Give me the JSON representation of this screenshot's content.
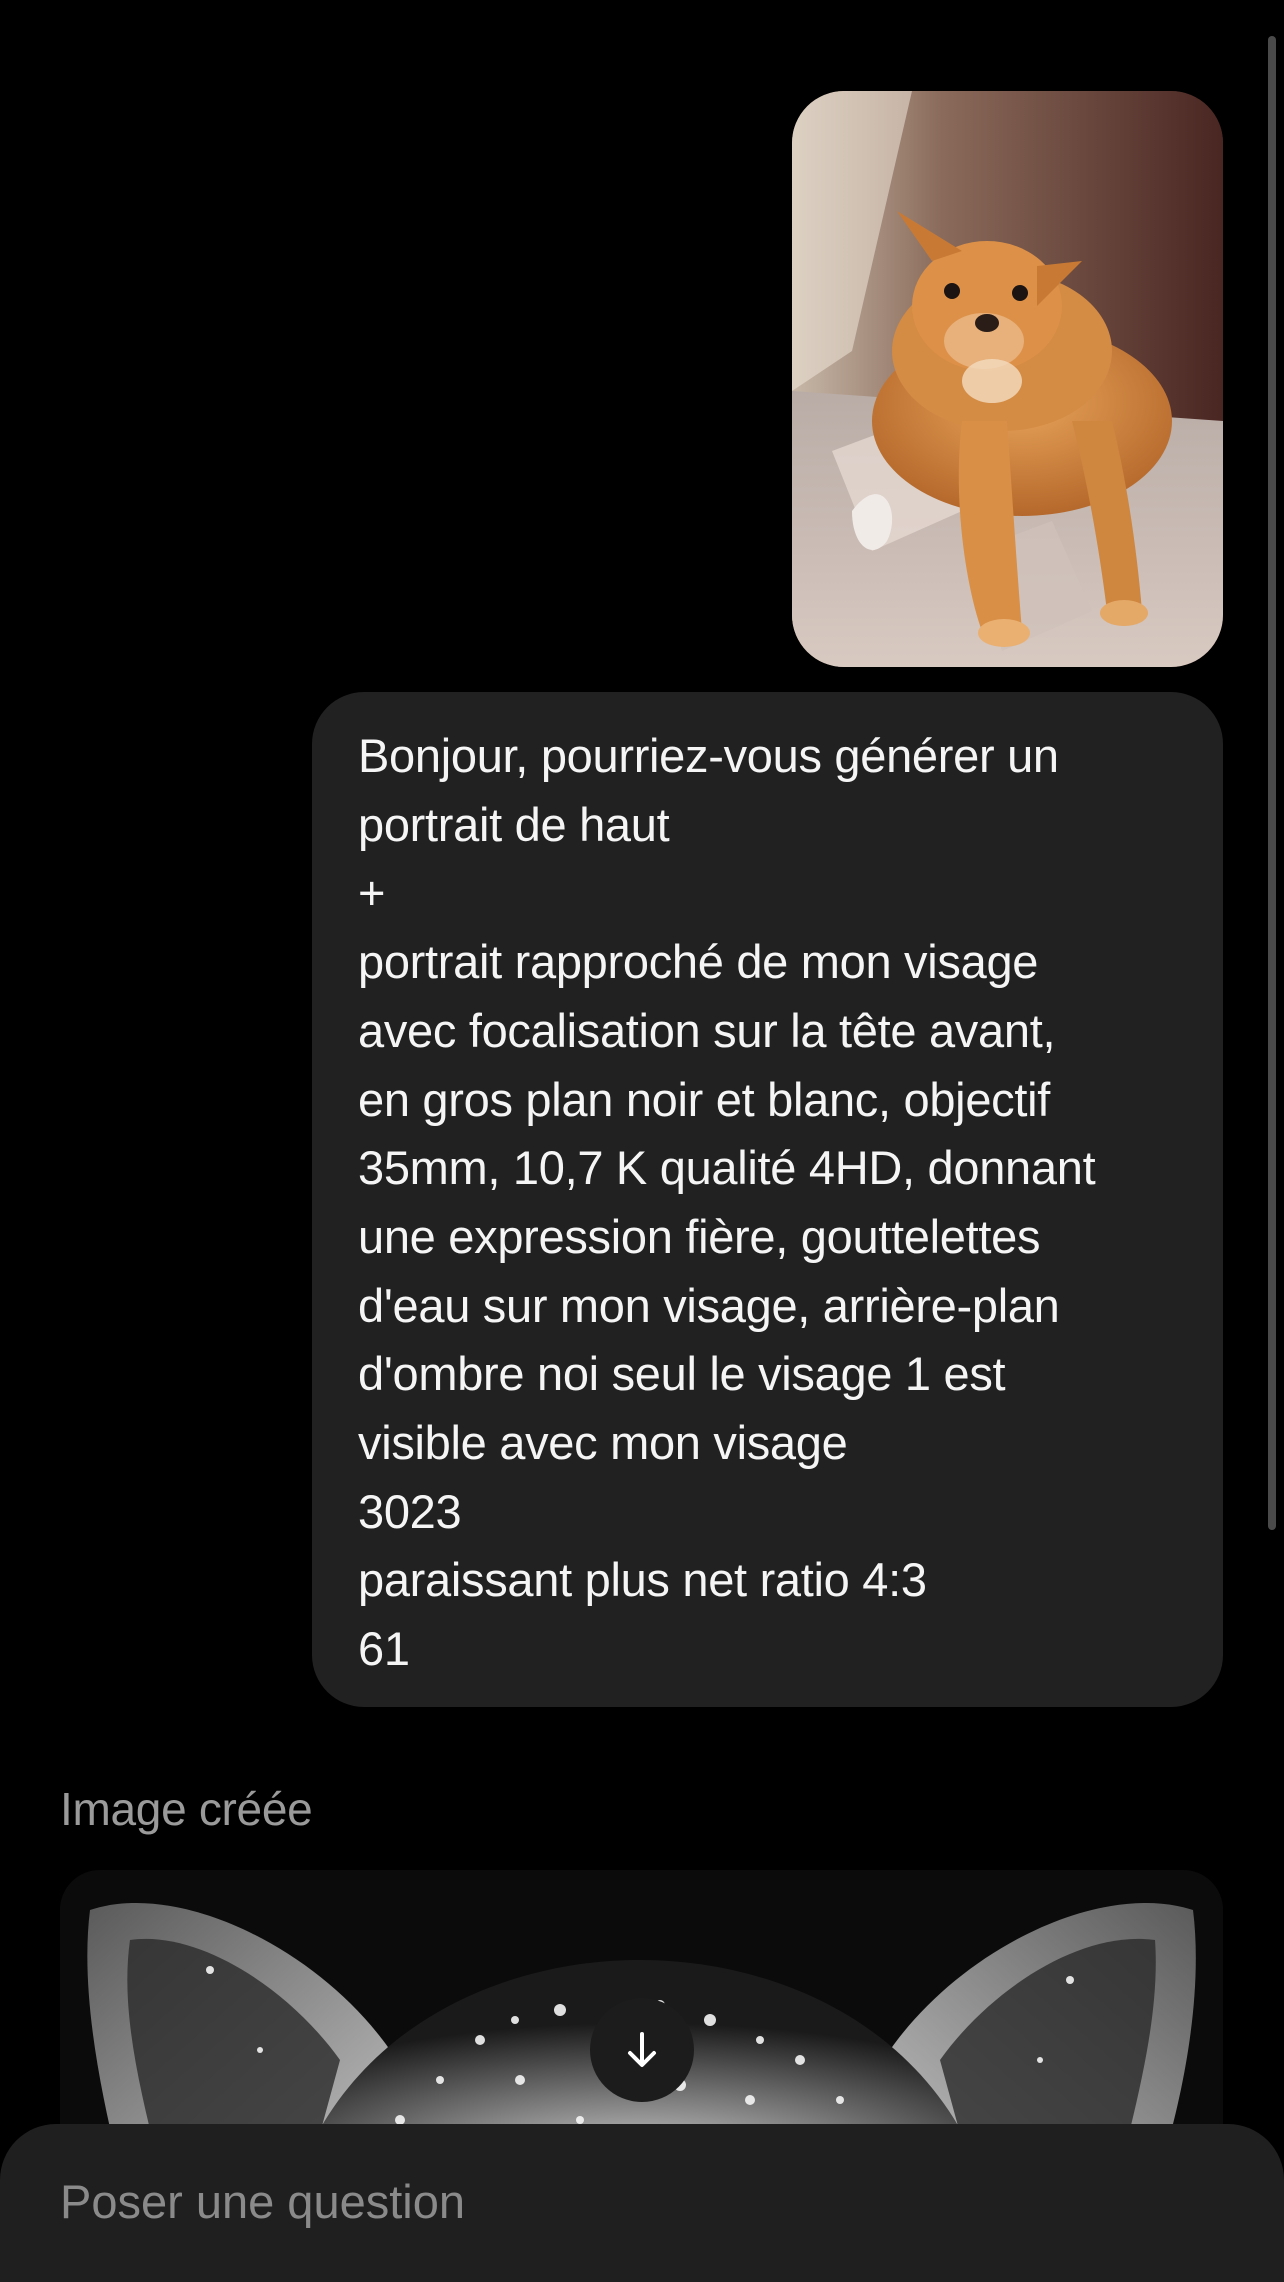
{
  "conversation": {
    "user_photo": {
      "icon": "dog-photo",
      "alt": "photo of a small ginger chihuahua lying on a blanket"
    },
    "user_message": {
      "lines": [
        "Bonjour, pourriez-vous générer un",
        "portrait de haut",
        "+",
        "portrait rapproché de mon visage",
        "avec focalisation sur la tête avant,",
        "en gros plan noir et blanc, objectif",
        "35mm, 10,7 K qualité 4HD, donnant",
        "une expression fière, gouttelettes",
        "d'eau sur mon visage, arrière-plan",
        "d'ombre noi seul le visage 1 est",
        "visible avec mon visage",
        "3023",
        "paraissant plus net ratio 4:3",
        "61"
      ]
    },
    "created_label": "Image créée",
    "generated_image": {
      "icon": "dog-portrait-bw"
    },
    "scroll_down": {
      "icon": "arrow-down-icon"
    }
  },
  "composer": {
    "placeholder": "Poser une question",
    "value": ""
  },
  "colors": {
    "background": "#000000",
    "bubble": "#212121",
    "composer": "#1f1f1f",
    "text": "#f5f5f5",
    "muted": "#9a9a9a"
  }
}
